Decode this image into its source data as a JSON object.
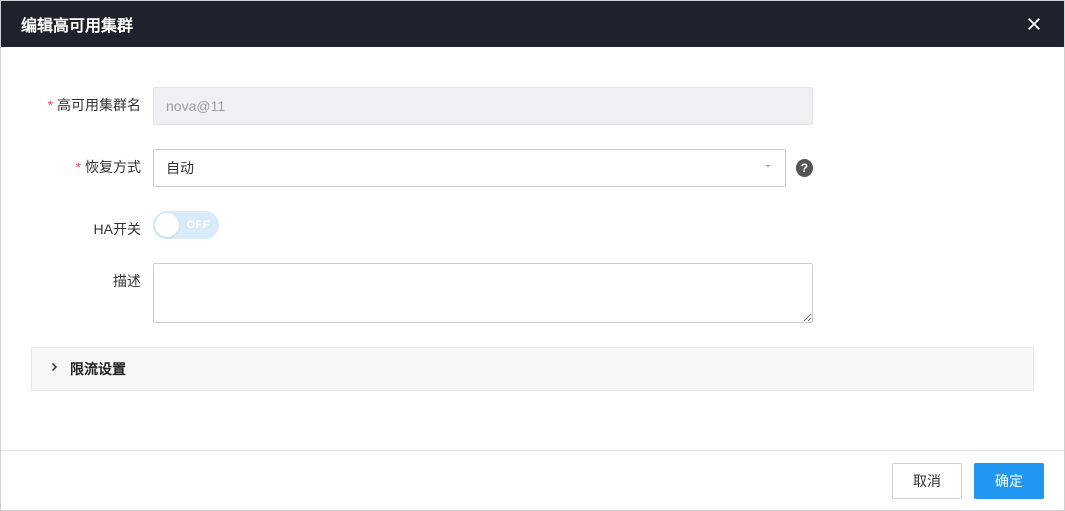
{
  "header": {
    "title": "编辑高可用集群"
  },
  "form": {
    "cluster_name": {
      "label": "高可用集群名",
      "value": "nova@11"
    },
    "recovery_mode": {
      "label": "恢复方式",
      "selected": "自动"
    },
    "ha_switch": {
      "label": "HA开关",
      "state": "OFF"
    },
    "description": {
      "label": "描述",
      "value": ""
    }
  },
  "collapse": {
    "throttle": {
      "title": "限流设置"
    }
  },
  "footer": {
    "cancel": "取消",
    "confirm": "确定"
  }
}
